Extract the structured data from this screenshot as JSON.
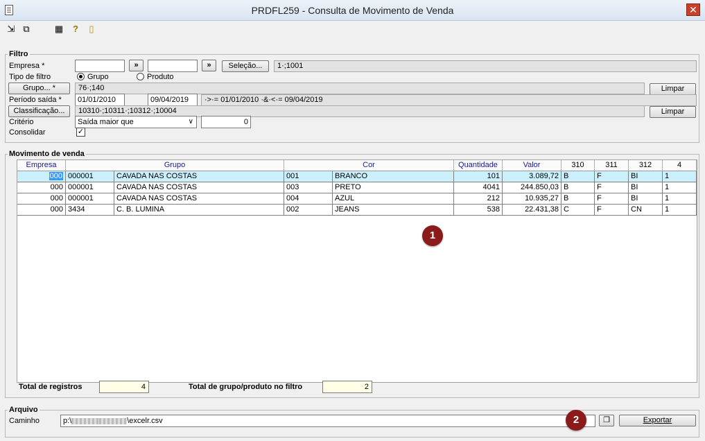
{
  "window": {
    "title": "PRDFL259 - Consulta de Movimento de Venda",
    "close": "✕"
  },
  "toolbar": {
    "icons": [
      "arrow-return-icon",
      "copy-icon",
      "table-icon",
      "help-icon",
      "exit-door-icon"
    ]
  },
  "filtro": {
    "title": "Filtro",
    "empresa_label": "Empresa *",
    "empresa_from": "",
    "empresa_to": "",
    "arrow_btn": "»",
    "selecao_btn": "Seleção...",
    "selecao_value": "1·;1001",
    "tipo_label": "Tipo de filtro",
    "radio_grupo": "Grupo",
    "radio_produto": "Produto",
    "grupo_btn": "Grupo... *",
    "grupo_value": "76·;140",
    "limpar": "Limpar",
    "periodo_label": "Período saída *",
    "periodo_de": "01/01/2010",
    "periodo_ate": "09/04/2019",
    "periodo_expr": "·>·= 01/01/2010 ·&·<·= 09/04/2019",
    "classif_btn": "Classificação...",
    "classif_value": "10310·;10311·;10312·;10004",
    "criterio_label": "Critério",
    "criterio_value": "Saída maior que",
    "criterio_num": "0",
    "consolidar_label": "Consolidar",
    "consolidar_check": "✓"
  },
  "movimento": {
    "title": "Movimento de venda",
    "headers": [
      "Empresa",
      "Grupo",
      "Cor",
      "Quantidade",
      "Valor",
      "310",
      "311",
      "312",
      "4"
    ],
    "rows": [
      [
        "000",
        "000001",
        "CAVADA NAS COSTAS",
        "001",
        "BRANCO",
        "101",
        "3.089,72",
        "B",
        "F",
        "BI",
        "1"
      ],
      [
        "000",
        "000001",
        "CAVADA NAS COSTAS",
        "003",
        "PRETO",
        "4041",
        "244.850,03",
        "B",
        "F",
        "BI",
        "1"
      ],
      [
        "000",
        "000001",
        "CAVADA NAS COSTAS",
        "004",
        "AZUL",
        "212",
        "10.935,27",
        "B",
        "F",
        "BI",
        "1"
      ],
      [
        "000",
        "3434",
        "C. B. LUMINA",
        "002",
        "JEANS",
        "538",
        "22.431,38",
        "C",
        "F",
        "CN",
        "1"
      ]
    ],
    "total_registros_label": "Total de registros",
    "total_registros": "4",
    "total_grupo_label": "Total de grupo/produto no filtro",
    "total_grupo": "2"
  },
  "arquivo": {
    "title": "Arquivo",
    "caminho_label": "Caminho",
    "caminho_prefix": "p:\\",
    "caminho_suffix": "\\excelr.csv",
    "exportar": "Exportar"
  },
  "badges": {
    "one": "1",
    "two": "2"
  }
}
